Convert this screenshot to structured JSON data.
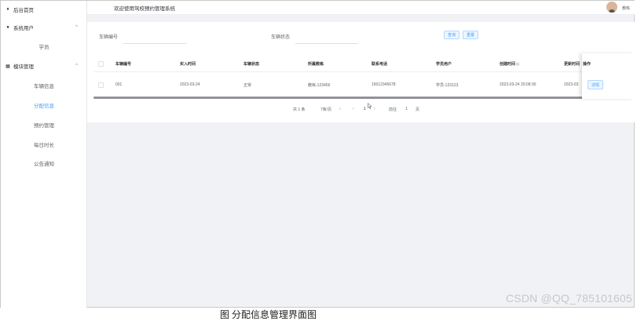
{
  "sidebar": {
    "home": "后台首页",
    "group1": {
      "label": "系统用户",
      "items": [
        "学员"
      ]
    },
    "group2": {
      "label": "模块管理",
      "items": [
        "车辆信息",
        "分配信息",
        "预约管理",
        "每日时长",
        "公告通知"
      ]
    }
  },
  "header": {
    "welcome": "欢迎使用驾校预约管理系统",
    "user": "教练"
  },
  "search": {
    "vehicle_no_label": "车辆编号",
    "vehicle_status_label": "车辆状态",
    "query_button": "查询",
    "reset_button": "重置"
  },
  "table": {
    "columns": [
      "车辆编号",
      "买入时间",
      "车辆状态",
      "所属教练",
      "联系电话",
      "学员用户",
      "创建时间 ◇",
      "更新时间",
      "操作"
    ],
    "rows": [
      [
        "001",
        "2023-03-24",
        "正常",
        "教练-123456",
        "15012345678",
        "学员-123123",
        "2023-03-24 20:08:30",
        "2023-03",
        "详情"
      ]
    ]
  },
  "pagination": {
    "total": "共 1 条",
    "page_size": "7条/页",
    "prev": "<",
    "current": "1",
    "next": ">",
    "goto": "前往",
    "goto_value": "1",
    "page_unit": "页"
  },
  "watermark": "CSDN @QQ_785101605",
  "caption": "图 分配信息管理界面图"
}
